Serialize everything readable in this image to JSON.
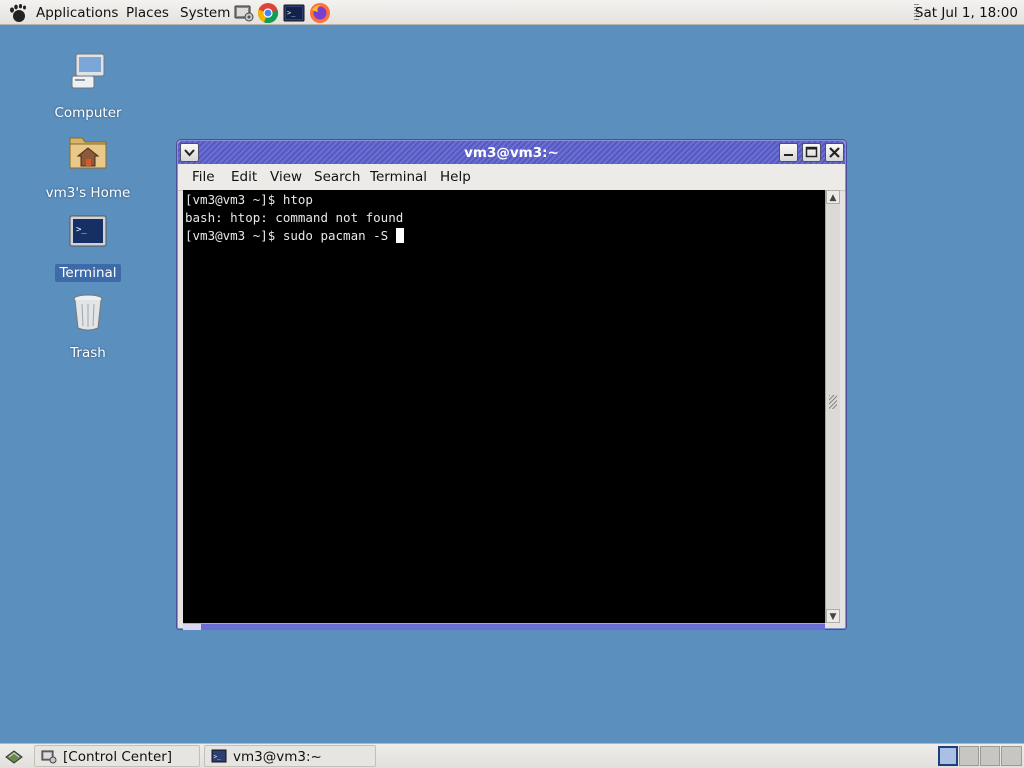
{
  "top_panel": {
    "menus": [
      "Applications",
      "Places",
      "System"
    ],
    "launchers": [
      "control-center-icon",
      "chrome-icon",
      "terminal-icon",
      "firefox-icon"
    ],
    "clock": "Sat Jul  1, 18:00"
  },
  "desktop": {
    "icons": [
      {
        "label": "Computer",
        "icon": "computer-icon"
      },
      {
        "label": "vm3's Home",
        "icon": "home-folder-icon"
      },
      {
        "label": "Terminal",
        "icon": "terminal-icon",
        "selected": true
      },
      {
        "label": "Trash",
        "icon": "trash-icon"
      }
    ]
  },
  "window": {
    "title": "vm3@vm3:~",
    "menu": [
      "File",
      "Edit",
      "View",
      "Search",
      "Terminal",
      "Help"
    ],
    "lines": [
      "[vm3@vm3 ~]$ htop",
      "bash: htop: command not found",
      "[vm3@vm3 ~]$ sudo pacman -S "
    ]
  },
  "bottom_panel": {
    "tasks": [
      "[Control Center]",
      "vm3@vm3:~"
    ],
    "workspaces": 4,
    "active_workspace": 1
  },
  "colors": {
    "desktop": "#5a8fbe",
    "titlebar": "#6b6fd1",
    "selection": "#3d6aa8",
    "terminal_bg": "#000000"
  }
}
